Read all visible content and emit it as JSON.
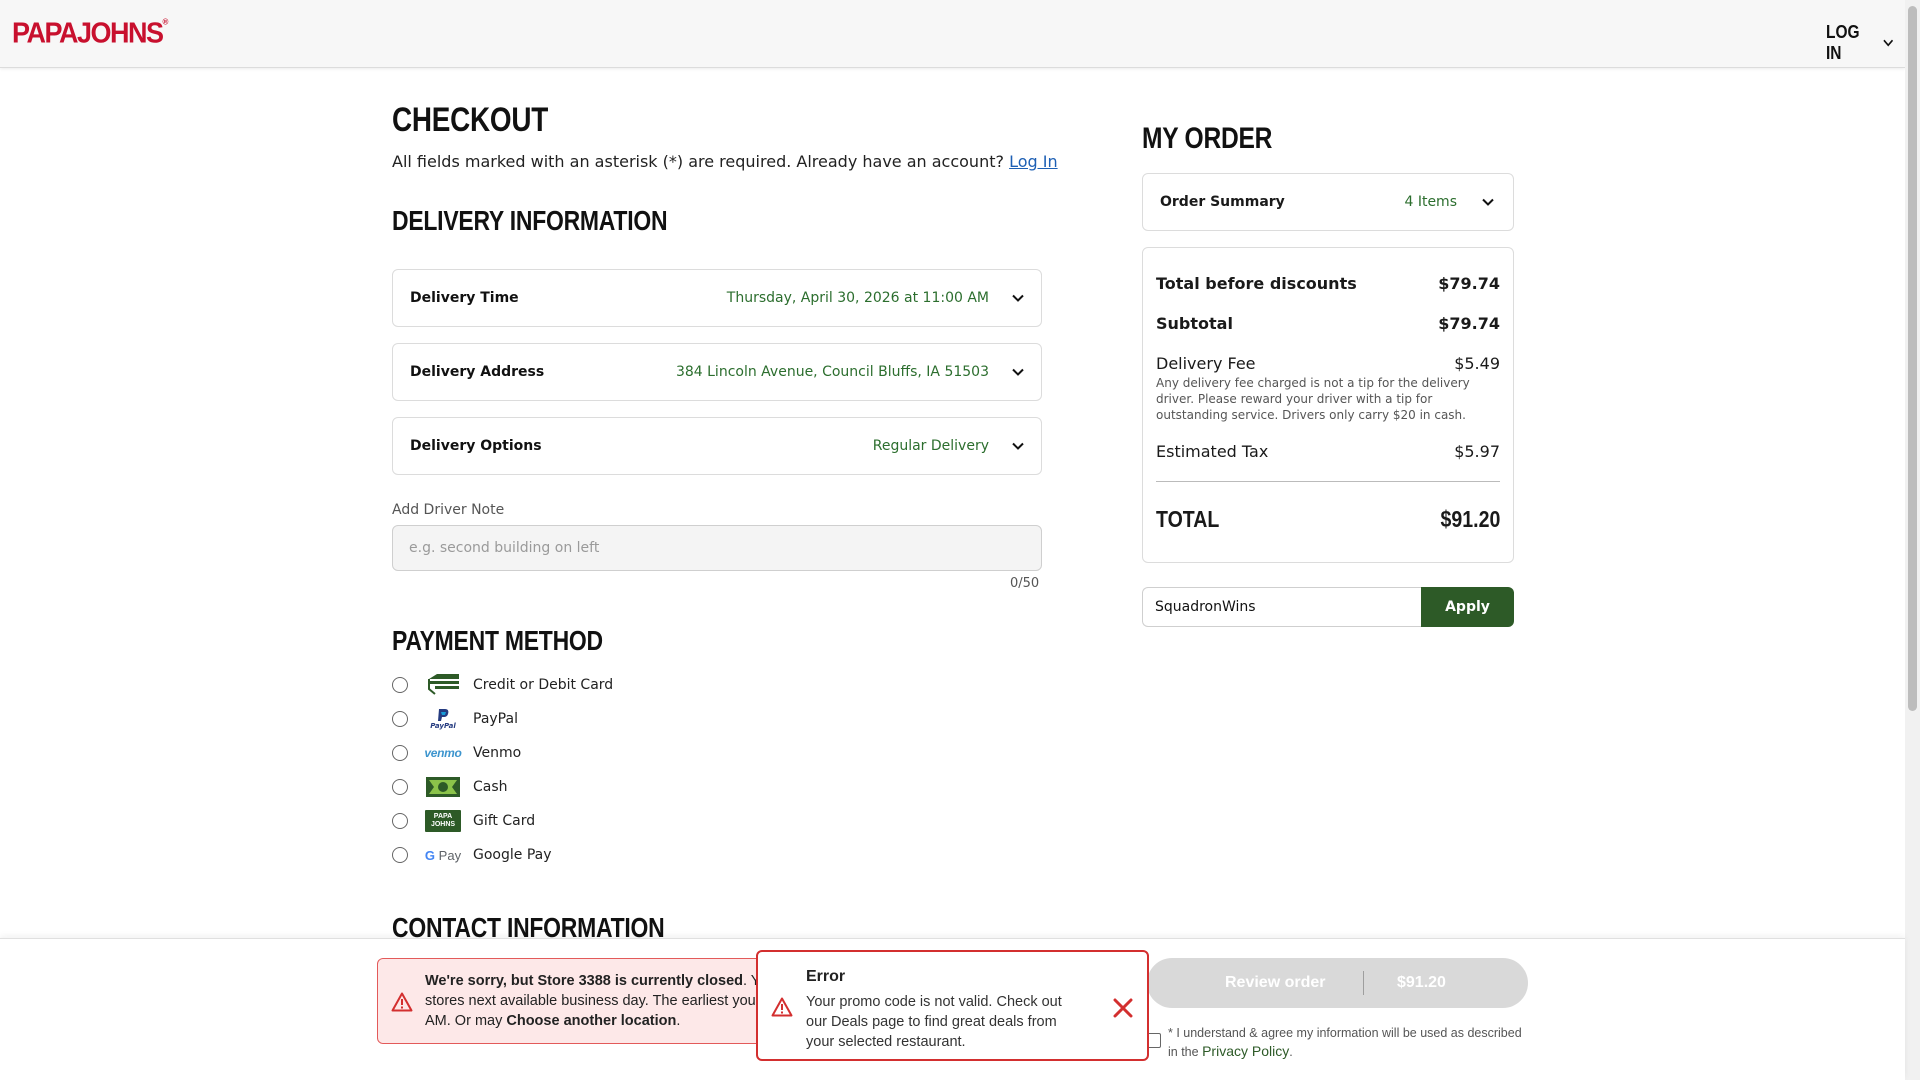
{
  "header": {
    "logo": "PAPAJOHNS",
    "logo_mark": "®",
    "login_label": "LOG IN"
  },
  "checkout": {
    "title": "CHECKOUT",
    "required_note": "All fields marked with an asterisk (*) are required. Already have an account?",
    "login_link": "Log In"
  },
  "delivery": {
    "title": "DELIVERY INFORMATION",
    "rows": [
      {
        "label": "Delivery Time",
        "value": "Thursday, April 30, 2026 at 11:00 AM"
      },
      {
        "label": "Delivery Address",
        "value": "384 Lincoln Avenue, Council Bluffs, IA 51503"
      },
      {
        "label": "Delivery Options",
        "value": "Regular Delivery"
      }
    ],
    "note_label": "Add Driver Note",
    "note_placeholder": "e.g. second building on left",
    "note_value": "",
    "note_count": "0/50"
  },
  "payment": {
    "title": "PAYMENT METHOD",
    "methods": [
      {
        "label": "Credit or Debit Card",
        "icon": "credit-card-icon"
      },
      {
        "label": "PayPal",
        "icon": "paypal-icon",
        "icon_text": "PayPal"
      },
      {
        "label": "Venmo",
        "icon": "venmo-icon",
        "icon_text": "venmo"
      },
      {
        "label": "Cash",
        "icon": "cash-icon"
      },
      {
        "label": "Gift Card",
        "icon": "gift-card-icon",
        "icon_text": "PAPA JOHNS"
      },
      {
        "label": "Google Pay",
        "icon": "google-pay-icon",
        "icon_text": "Pay"
      }
    ]
  },
  "contact": {
    "title": "CONTACT INFORMATION"
  },
  "order": {
    "title": "MY ORDER",
    "summary_label": "Order Summary",
    "item_count": "4 Items",
    "total_before_label": "Total before discounts",
    "total_before": "$79.74",
    "subtotal_label": "Subtotal",
    "subtotal": "$79.74",
    "delivery_fee_label": "Delivery Fee",
    "delivery_fee": "$5.49",
    "delivery_fee_note": "Any delivery fee charged is not a tip for the delivery driver. Please reward your driver with a tip for outstanding service. Drivers only carry $20 in cash.",
    "tax_label": "Estimated Tax",
    "tax": "$5.97",
    "total_label": "TOTAL",
    "total": "$91.20",
    "promo_value": "SquadronWins",
    "apply_label": "Apply"
  },
  "alerts": {
    "closed_line1_bold": "We're sorry, but Store 3388 is currently closed",
    "closed_line1_rest": ". Yo",
    "closed_line2": "stores next available business day. The earliest your o",
    "closed_line3_pre": "AM. Or may ",
    "closed_line3_bold": "Choose another location",
    "closed_line3_post": ".",
    "error_title": "Error",
    "error_message": "Your promo code is not valid. Check out our Deals page to find great deals from your selected restaurant."
  },
  "footer": {
    "review_label": "Review order",
    "review_amount": "$91.20",
    "agree_text": "* I understand & agree my information will be used as described in the",
    "privacy_link": "Privacy Policy",
    "agree_end": "."
  },
  "colors": {
    "brand_red": "#c8102e",
    "accent_green": "#2d5a27",
    "error_red": "#d32f2f"
  }
}
